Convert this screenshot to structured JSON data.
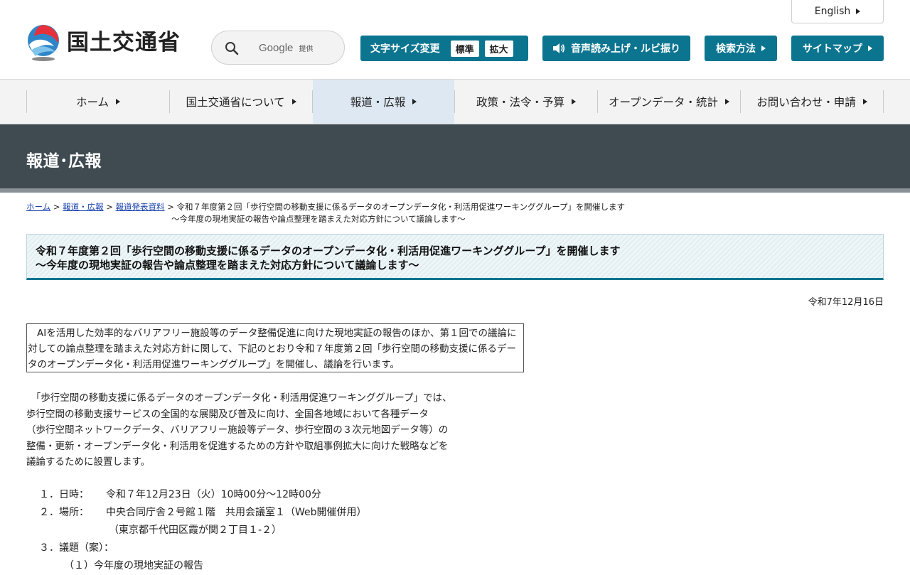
{
  "header": {
    "logo_text": "国土交通省",
    "search": {
      "brand": "Google",
      "brand_suffix": "提供",
      "placeholder": ""
    },
    "english_label": "English",
    "font_size": {
      "label": "文字サイズ変更",
      "standard": "標準",
      "large": "拡大"
    },
    "voice_label": "音声読み上げ・ルビ振り",
    "search_method_label": "検索方法",
    "sitemap_label": "サイトマップ"
  },
  "gnav": {
    "items": [
      {
        "label": "ホーム"
      },
      {
        "label": "国土交通省について"
      },
      {
        "label": "報道・広報"
      },
      {
        "label": "政策・法令・予算"
      },
      {
        "label": "オープンデータ・統計"
      },
      {
        "label": "お問い合わせ・申請"
      }
    ]
  },
  "page_title": "報道･広報",
  "breadcrumb": {
    "home": "ホーム",
    "press": "報道・広報",
    "releases": "報道発表資料",
    "sep": ">",
    "current_line1": "令和７年度第２回「歩行空間の移動支援に係るデータのオープンデータ化・利活用促進ワーキンググループ」を開催します",
    "current_line2": "～今年度の現地実証の報告や論点整理を踏まえた対応方針について議論します～"
  },
  "article": {
    "title_line1": "令和７年度第２回「歩行空間の移動支援に係るデータのオープンデータ化・利活用促進ワーキンググループ」を開催します",
    "title_line2": "～今年度の現地実証の報告や論点整理を踏まえた対応方針について議論します～",
    "date": "令和7年12月16日",
    "summary": "AIを活用した効率的なバリアフリー施設等のデータ整備促進に向けた現地実証の報告のほか、第１回での議論に対しての論点整理を踏まえた対応方針に関して、下記のとおり令和７年度第２回「歩行空間の移動支援に係るデータのオープンデータ化・利活用促進ワーキンググループ」を開催し、議論を行います。",
    "intro_lines": [
      "　「歩行空間の移動支援に係るデータのオープンデータ化・利活用促進ワーキンググループ」では、",
      "歩行空間の移動支援サービスの全国的な展開及び普及に向け、全国各地域において各種データ",
      "（歩行空間ネットワークデータ、バリアフリー施設等データ、歩行空間の３次元地図データ等）の",
      "整備・更新・オープンデータ化・利活用を促進するための方針や取組事例拡大に向けた戦略などを",
      "議論するために設置します。"
    ],
    "details": {
      "datetime_label": "１．日時：",
      "datetime_value": "令和７年12月23日（火）10時00分～12時00分",
      "place_label": "２．場所：",
      "place_value": "中央合同庁舎２号館１階　共用会議室１（Web開催併用）",
      "place_address": "（東京都千代田区霞が関２丁目１-２）",
      "agenda_label": "３．議題（案）：",
      "agenda_item1": "（１）今年度の現地実証の報告"
    }
  },
  "colors": {
    "teal": "#0b7590",
    "band": "#3f4b51",
    "nav_bg": "#f3f3f3",
    "nav_active": "#dde8f2"
  }
}
